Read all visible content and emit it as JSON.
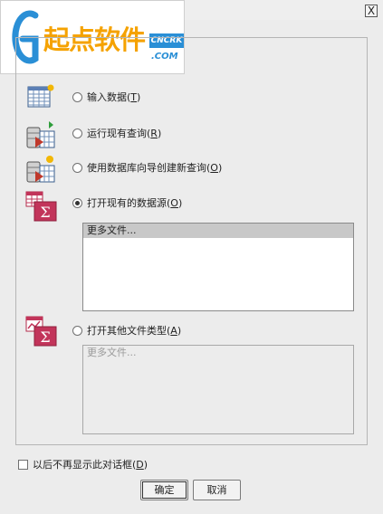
{
  "window": {
    "close_label": "X"
  },
  "watermark": {
    "brand_cn": "起点软件",
    "badge_top": "CNCRK",
    "badge_bottom": ".COM"
  },
  "options": [
    {
      "id": "input",
      "icon": "data-grid-icon",
      "label": "输入数据(",
      "key": "T",
      "selected": false
    },
    {
      "id": "run",
      "icon": "database-query-icon",
      "label": "运行现有查询(",
      "key": "R",
      "selected": false
    },
    {
      "id": "wizard",
      "icon": "database-wizard-icon",
      "label": "使用数据库向导创建新查询(",
      "key": "O",
      "selected": false
    },
    {
      "id": "open",
      "icon": "sigma-dataset-icon",
      "label": "打开现有的数据源(",
      "key": "O",
      "selected": true
    },
    {
      "id": "other",
      "icon": "sigma-chart-icon",
      "label": "打开其他文件类型(",
      "key": "A",
      "selected": false
    }
  ],
  "datasource_list": {
    "items": [
      "更多文件..."
    ]
  },
  "other_list": {
    "items": [
      "更多文件..."
    ]
  },
  "dont_show": {
    "label": "以后不再显示此对话框(",
    "key": "D",
    "checked": false
  },
  "buttons": {
    "ok": "确定",
    "cancel": "取消"
  }
}
